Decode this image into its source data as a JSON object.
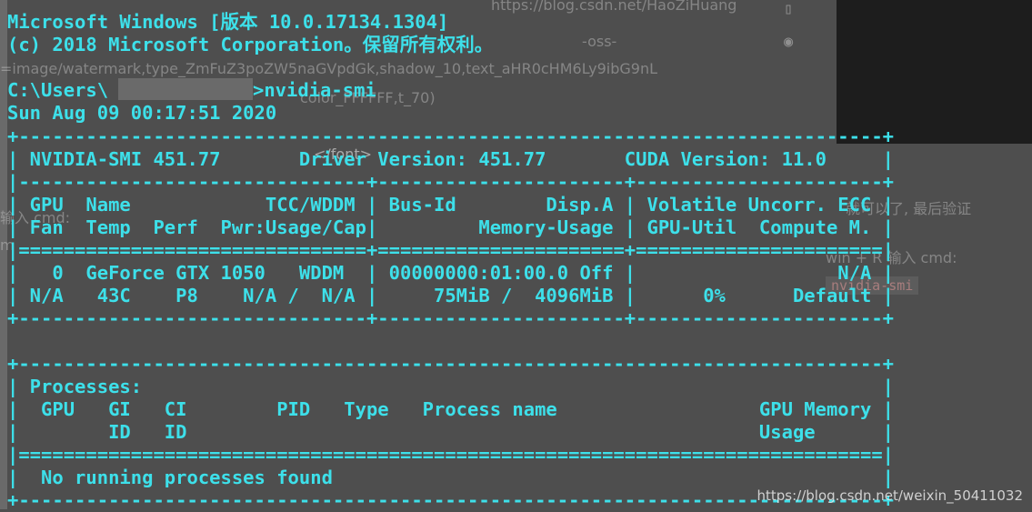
{
  "background": {
    "url": "https://blog.csdn.net/HaoZiHuang",
    "oss_tail": "-oss-",
    "image_param": "=image/watermark,type_ZmFuZ3poZW5naGVpdGk,shadow_10,text_aHR0cHM6Ly9ibG9nL",
    "color_param": "color_FFFFFF,t_70)",
    "tail_tag": "</font>",
    "left_cmd": "输入 cmd:",
    "left_m": "m",
    "right_verify": "就可以了, 最后验证",
    "right_win_r": "win + R 输入 cmd:",
    "right_code": "nvidia-smi",
    "watermark": "https://blog.csdn.net/weixin_50411032"
  },
  "console": {
    "header_1": "Microsoft Windows [版本 10.0.17134.1304]",
    "header_2": "(c) 2018 Microsoft Corporation。保留所有权利。",
    "prompt_prefix": "C:\\Users\\",
    "prompt_suffix": ">nvidia-smi",
    "timestamp": "Sun Aug 09 00:17:51 2020",
    "lines": [
      "+-----------------------------------------------------------------------------+",
      "| NVIDIA-SMI 451.77       Driver Version: 451.77       CUDA Version: 11.0     |",
      "|-------------------------------+----------------------+----------------------+",
      "| GPU  Name            TCC/WDDM | Bus-Id        Disp.A | Volatile Uncorr. ECC |",
      "| Fan  Temp  Perf  Pwr:Usage/Cap|         Memory-Usage | GPU-Util  Compute M. |",
      "|===============================+======================+======================|",
      "|   0  GeForce GTX 1050   WDDM  | 00000000:01:00.0 Off |                  N/A |",
      "| N/A   43C    P8    N/A /  N/A |     75MiB /  4096MiB |      0%      Default |",
      "+-------------------------------+----------------------+----------------------+",
      "",
      "+-----------------------------------------------------------------------------+",
      "| Processes:                                                                  |",
      "|  GPU   GI   CI        PID   Type   Process name                  GPU Memory |",
      "|        ID   ID                                                   Usage      |",
      "|=============================================================================|",
      "|  No running processes found                                                 |",
      "+-----------------------------------------------------------------------------+"
    ]
  }
}
